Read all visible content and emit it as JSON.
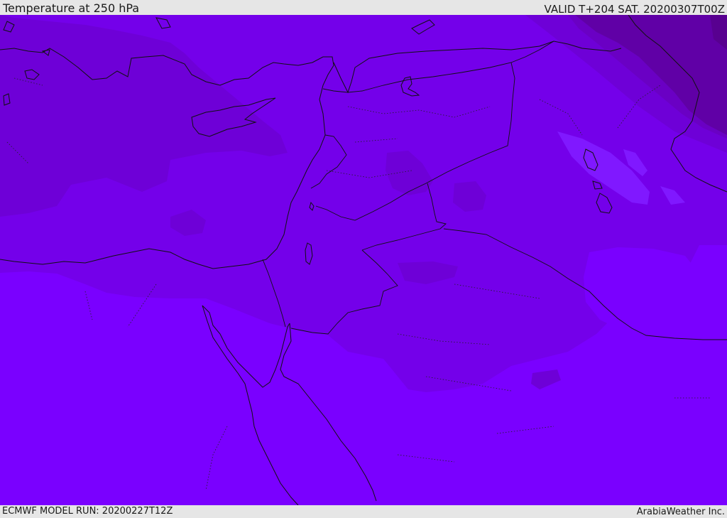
{
  "header": {
    "title": "Temperature at 250 hPa",
    "valid_time": "VALID T+204 SAT. 20200307T00Z"
  },
  "footer": {
    "model_run": "ECMWF MODEL RUN: 20200227T12Z",
    "credit": "ArabiaWeather Inc."
  },
  "map": {
    "field": "temperature",
    "level_hpa": 250,
    "colors": {
      "warmest_band": "#7a00ff",
      "band_2": "#7400ea",
      "band_3": "#6e00d7",
      "band_4": "#6a00c4",
      "band_5": "#6000a6",
      "darkest_band": "#580090",
      "cool_patch_light": "#8018ff",
      "coastline": "#111111"
    }
  }
}
